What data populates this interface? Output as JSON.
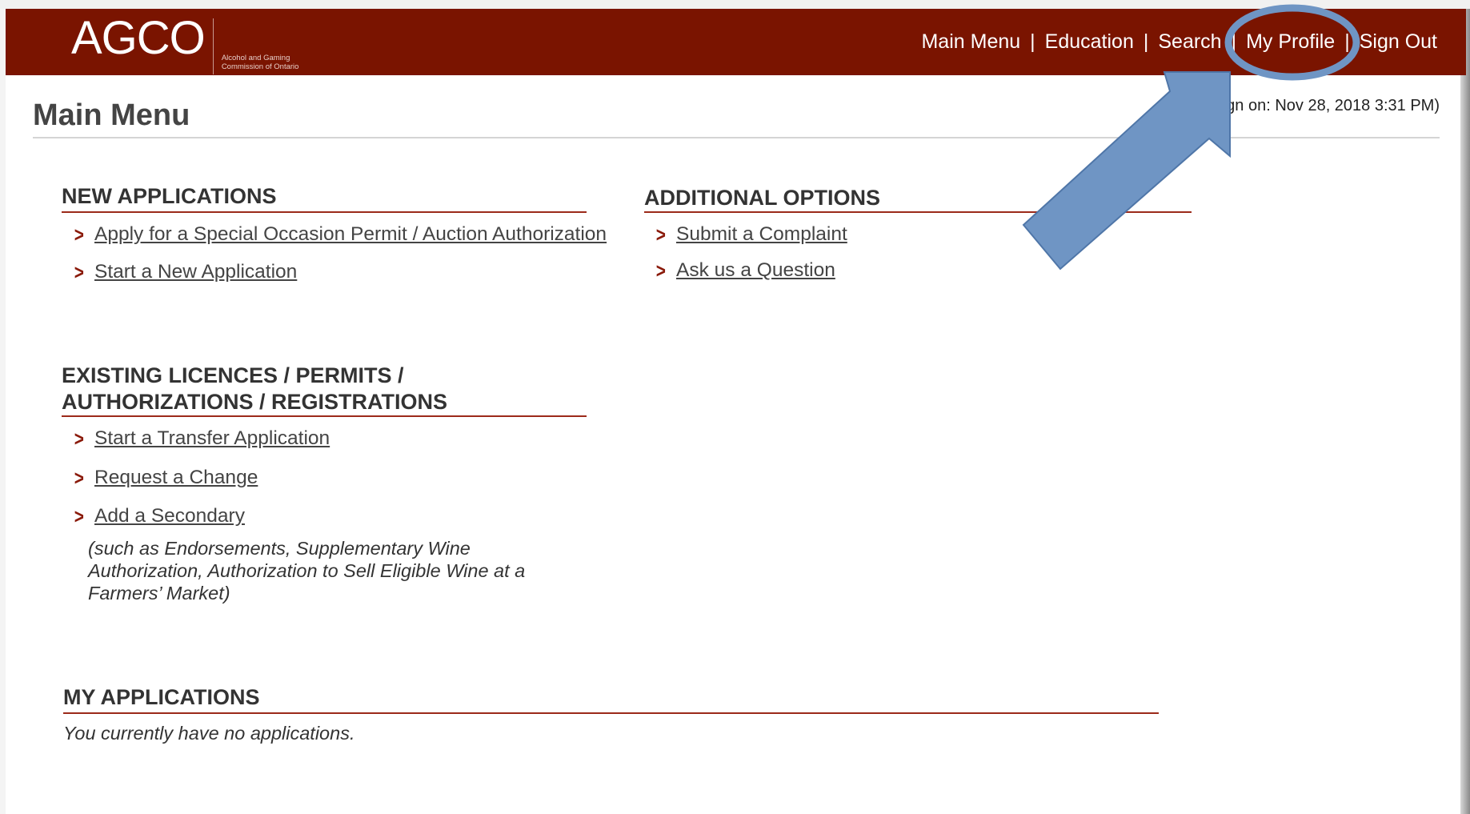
{
  "header": {
    "logo": "AGCO",
    "logo_subtitle_line1": "Alcohol and Gaming",
    "logo_subtitle_line2": "Commission of Ontario",
    "bg_color": "#7a1400",
    "nav": {
      "main_menu": "Main Menu",
      "education": "Education",
      "search": "Search",
      "my_profile": "My Profile",
      "sign_out": "Sign Out",
      "separator": "|"
    }
  },
  "page": {
    "title": "Main Menu",
    "last_signon": "ign on: Nov 28, 2018 3:31 PM)"
  },
  "new_applications": {
    "heading": "NEW APPLICATIONS",
    "links": [
      "Apply for a Special Occasion Permit / Auction Authorization",
      "Start a New Application"
    ]
  },
  "additional_options": {
    "heading": "ADDITIONAL OPTIONS",
    "links": [
      "Submit a Complaint",
      "Ask us a Question"
    ]
  },
  "existing": {
    "heading_line1": "EXISTING LICENCES / PERMITS /",
    "heading_line2": "AUTHORIZATIONS / REGISTRATIONS",
    "links": [
      "Start a Transfer Application",
      "Request a Change",
      "Add a Secondary"
    ],
    "note_line1": "(such as Endorsements, Supplementary Wine",
    "note_line2": "Authorization, Authorization to Sell Eligible Wine at a",
    "note_line3": "Farmers’ Market)"
  },
  "my_applications": {
    "heading": "MY APPLICATIONS",
    "empty_text": "You currently have no applications."
  },
  "colors": {
    "accent": "#7a1400",
    "rule": "#9c2a1a",
    "annotation": "#6f95c4"
  },
  "icons": {
    "link_bullet": "chevron-right-icon"
  }
}
